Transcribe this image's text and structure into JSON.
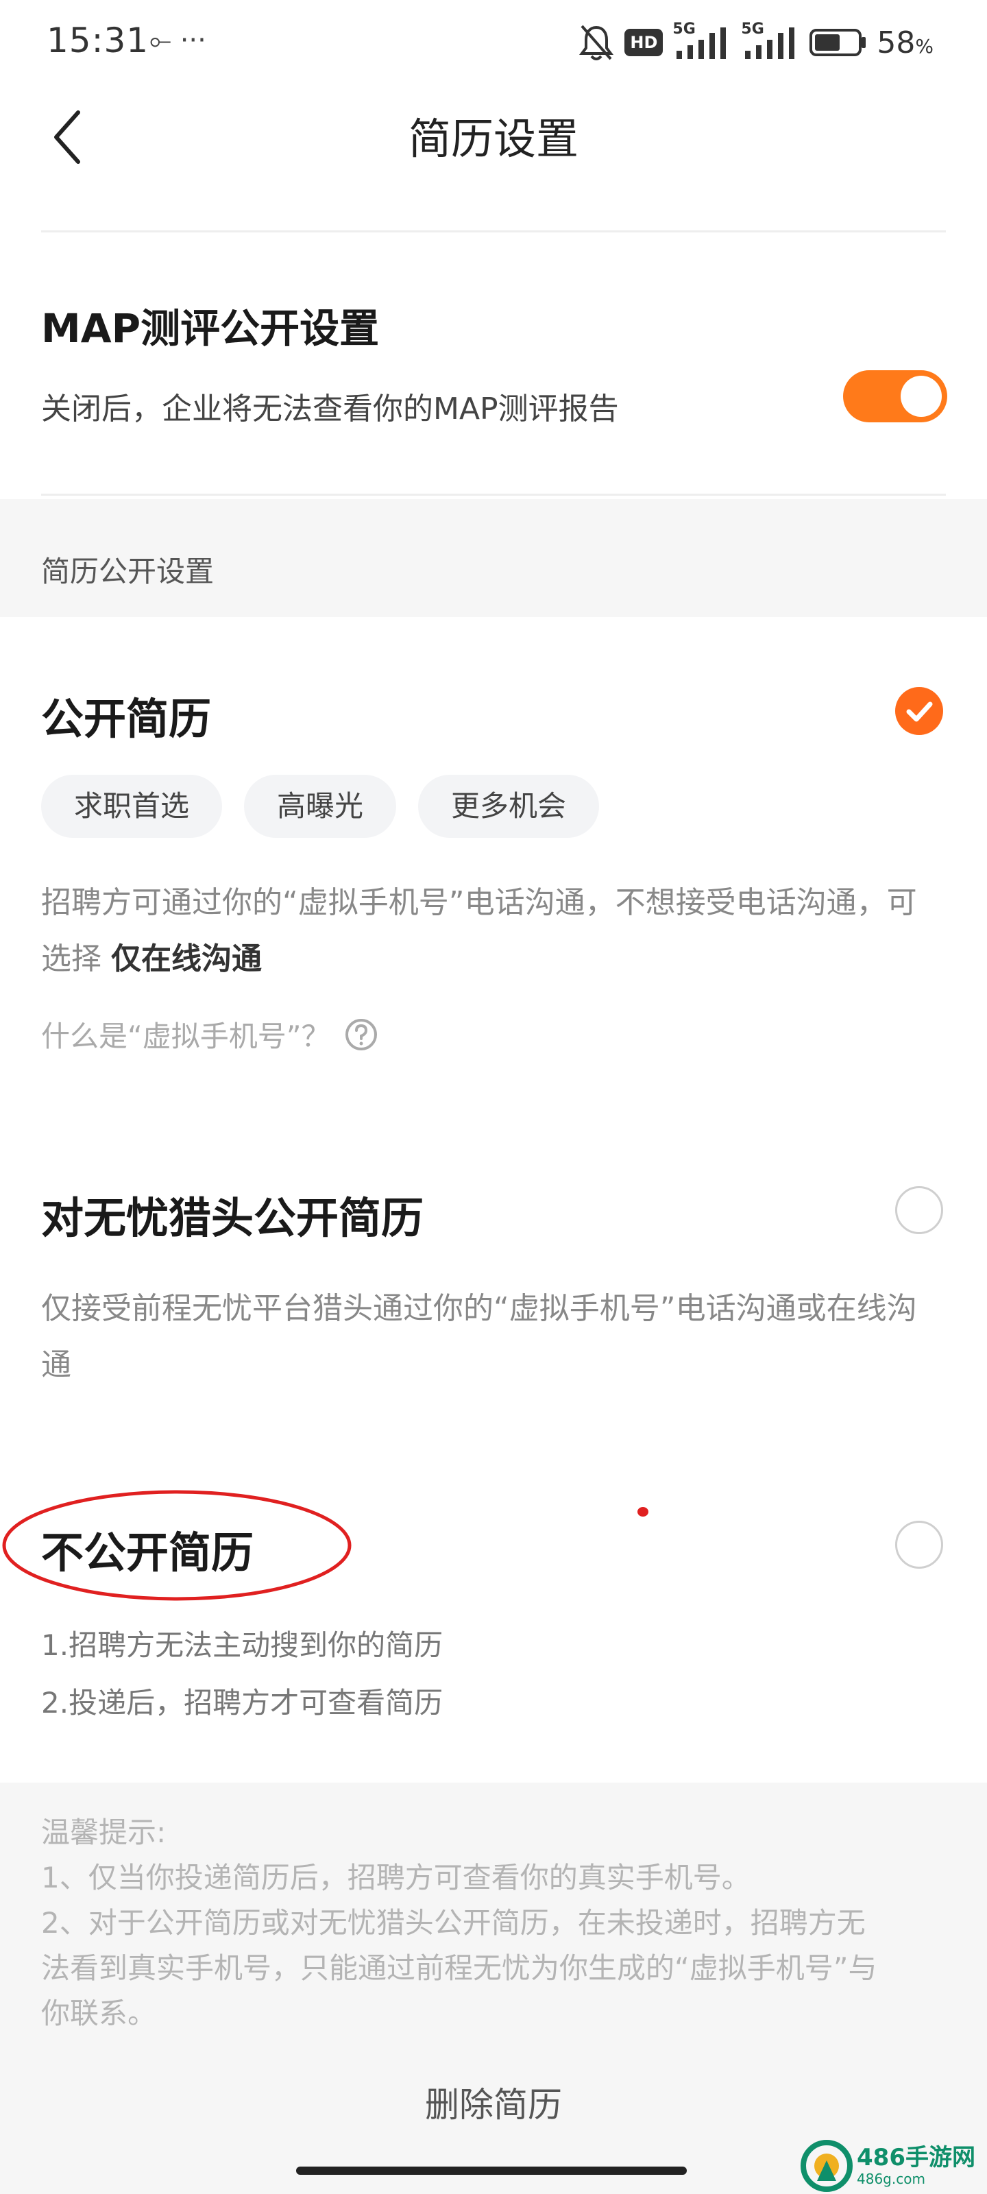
{
  "status_bar": {
    "time": "15:31",
    "extra_icons": "⟜ ···",
    "hd_label": "HD",
    "network_1": "5G",
    "network_2": "5G",
    "battery_percent": "58",
    "battery_unit": "%",
    "battery_level": 0.58
  },
  "header": {
    "title": "简历设置"
  },
  "map_section": {
    "title": "MAP测评公开设置",
    "description": "关闭后，企业将无法查看你的MAP测评报告",
    "toggle_on": true
  },
  "resume_section": {
    "header": "简历公开设置",
    "options": [
      {
        "title": "公开简历",
        "selected": true,
        "tags": [
          "求职首选",
          "高曝光",
          "更多机会"
        ],
        "description_line1": "招聘方可通过你的“虚拟手机号”电话沟通，不想接受电话沟通，可",
        "description_line2_prefix": "选择 ",
        "description_line2_bold": "仅在线沟通",
        "help_text": "什么是“虚拟手机号”？"
      },
      {
        "title": "对无忧猎头公开简历",
        "selected": false,
        "description_line1": "仅接受前程无忧平台猎头通过你的“虚拟手机号”电话沟通或在线沟",
        "description_line2": "通"
      },
      {
        "title": "不公开简历",
        "selected": false,
        "lines": [
          "1.招聘方无法主动搜到你的简历",
          "2.投递后，招聘方才可查看简历"
        ]
      }
    ]
  },
  "tips": {
    "title": "温馨提示:",
    "lines": [
      "1、仅当你投递简历后，招聘方可查看你的真实手机号。",
      "2、对于公开简历或对无忧猎头公开简历，在未投递时，招聘方无",
      "法看到真实手机号，只能通过前程无忧为你生成的“虚拟手机号”与",
      "你联系。"
    ]
  },
  "footer": {
    "delete_label": "删除简历"
  },
  "watermark": {
    "name": "486手游网",
    "url": "486g.com"
  },
  "colors": {
    "accent": "#ff6a1a",
    "annotation": "#e02020",
    "watermark": "#0f8f6a"
  }
}
